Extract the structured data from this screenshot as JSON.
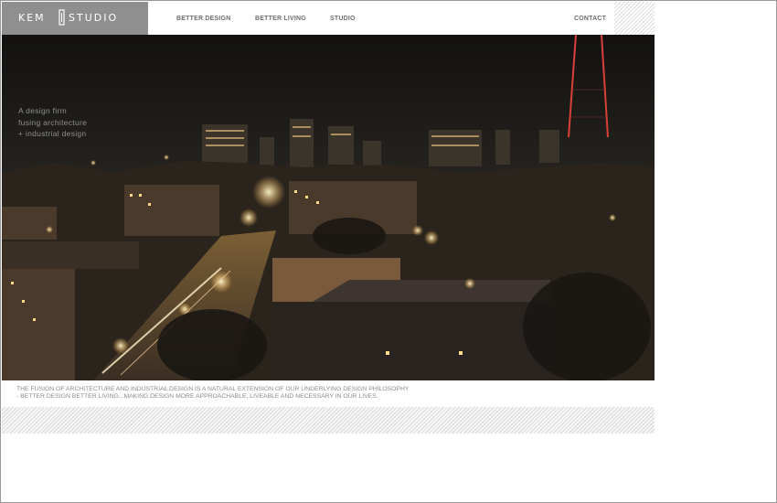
{
  "logo": {
    "left_text": "KEM",
    "right_text": "STUDIO"
  },
  "nav": {
    "items": [
      {
        "label": "BETTER DESIGN"
      },
      {
        "label": "BETTER LIVING"
      },
      {
        "label": "STUDIO"
      }
    ],
    "contact_label": "CONTACT"
  },
  "hero": {
    "tagline": [
      "A design firm",
      "fusing architecture",
      "+ industrial design"
    ]
  },
  "philosophy": {
    "lines": [
      "THE FUSION OF ARCHITECTURE AND INDUSTRIAL DESIGN IS A NATURAL EXTENSION OF OUR UNDERLYING DESIGN PHILOSOPHY",
      "- BETTER DESIGN BETTER LIVING...MAKING DESIGN MORE APPROACHABLE, LIVEABLE AND NECESSARY IN OUR LIVES."
    ]
  },
  "colors": {
    "logo_bg": "#8f8f8f",
    "nav_text": "#6e6e6e",
    "body_text": "#8a8a8a",
    "night_sky": "#1b1915"
  }
}
